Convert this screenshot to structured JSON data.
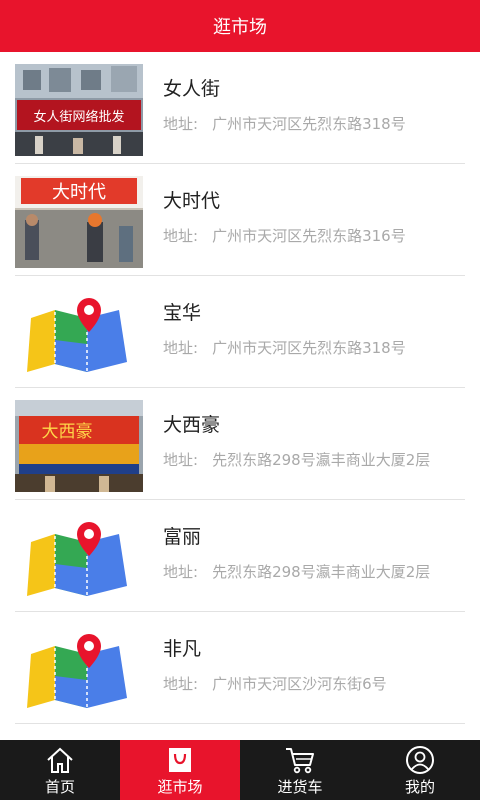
{
  "header": {
    "title": "逛市场"
  },
  "markets": [
    {
      "name": "女人街",
      "address_label": "地址:",
      "address": "广州市天河区先烈东路318号",
      "thumb": "storefront",
      "sign_text": "女人街网络批发"
    },
    {
      "name": "大时代",
      "address_label": "地址:",
      "address": "广州市天河区先烈东路316号",
      "thumb": "storefront",
      "sign_text": "大时代"
    },
    {
      "name": "宝华",
      "address_label": "地址:",
      "address": "广州市天河区先烈东路318号",
      "thumb": "map-icon"
    },
    {
      "name": "大西豪",
      "address_label": "地址:",
      "address": "先烈东路298号瀛丰商业大厦2层",
      "thumb": "storefront",
      "sign_text": "大西豪"
    },
    {
      "name": "富丽",
      "address_label": "地址:",
      "address": "先烈东路298号瀛丰商业大厦2层",
      "thumb": "map-icon"
    },
    {
      "name": "非凡",
      "address_label": "地址:",
      "address": "广州市天河区沙河东街6号",
      "thumb": "map-icon"
    }
  ],
  "tabs": [
    {
      "label": "首页",
      "icon": "home-icon",
      "active": false
    },
    {
      "label": "逛市场",
      "icon": "bag-icon",
      "active": true
    },
    {
      "label": "进货车",
      "icon": "cart-icon",
      "active": false
    },
    {
      "label": "我的",
      "icon": "user-icon",
      "active": false
    }
  ],
  "colors": {
    "brand": "#e8142c",
    "tabbar": "#1a1a1a",
    "address": "#a9a9a9"
  }
}
